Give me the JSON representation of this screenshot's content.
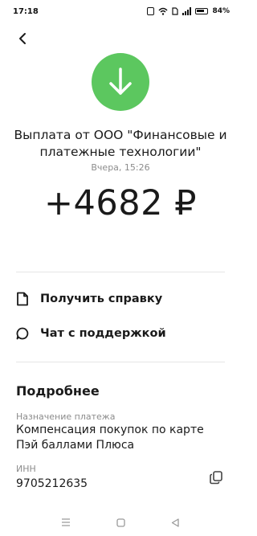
{
  "status_bar": {
    "time": "17:18",
    "battery": "84%",
    "icons": [
      "nfc-icon",
      "wifi-icon",
      "sim-icon",
      "signal-icon",
      "battery-icon"
    ]
  },
  "header": {
    "back_icon": "chevron-left-icon"
  },
  "transaction": {
    "icon": "arrow-down-icon",
    "icon_color": "#5cc75f",
    "title": "Выплата от ООО \"Финансовые и платежные технологии\"",
    "date": "Вчера, 15:26",
    "amount": "+4682 ₽"
  },
  "actions": [
    {
      "label": "Получить справку",
      "icon": "document-icon"
    },
    {
      "label": "Чат с поддержкой",
      "icon": "chat-icon"
    }
  ],
  "details": {
    "title": "Подробнее",
    "purpose_label": "Назначение платежа",
    "purpose_value": "Компенсация покупок по карте Пэй баллами Плюса",
    "inn_label": "ИНН",
    "inn_value": "9705212635",
    "copy_icon": "copy-icon"
  },
  "nav_bar": {
    "icons": [
      "menu-icon",
      "home-icon",
      "back-icon"
    ]
  }
}
